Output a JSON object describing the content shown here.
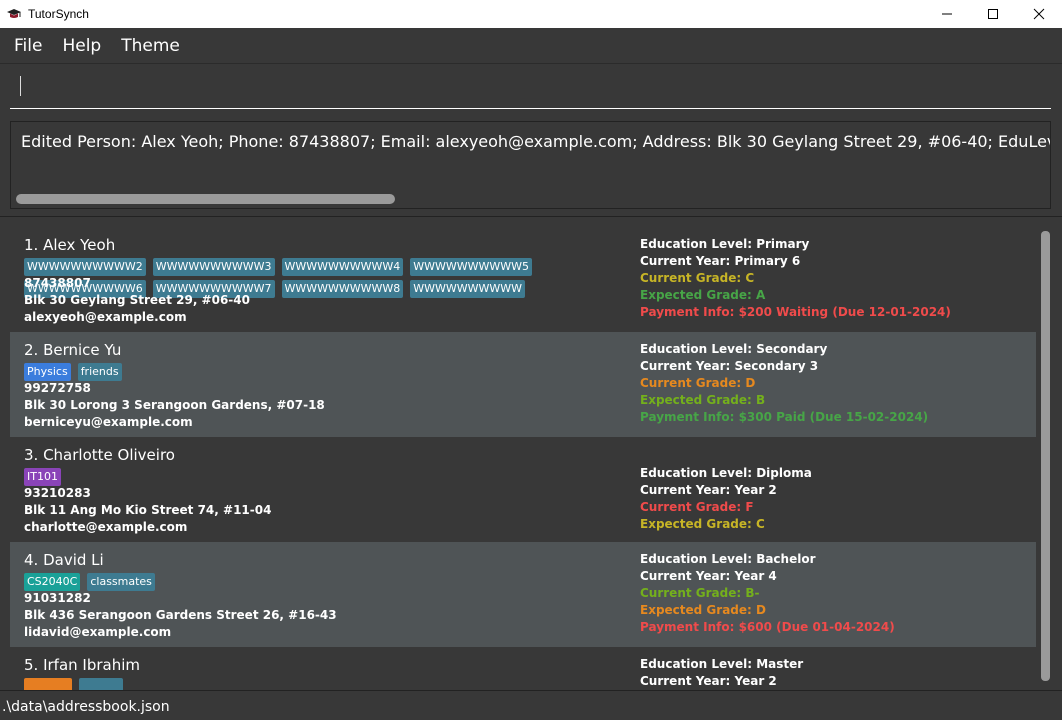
{
  "window": {
    "title": "TutorSynch"
  },
  "menu": [
    "File",
    "Help",
    "Theme"
  ],
  "command": {
    "value": ""
  },
  "result": {
    "text": "Edited Person: Alex Yeoh; Phone: 87438807; Email: alexyeoh@example.com; Address: Blk 30 Geylang Street 29, #06-40; EduLevel: Primary; Cu"
  },
  "colors": {
    "tag_default": "#3e7b91",
    "tag_physics": "#3b7ddd",
    "tag_it": "#8a44b8",
    "tag_cs": "#1aa198",
    "tag_orange": "#e67e22",
    "grade_yellow": "#c7b526",
    "grade_orange": "#e6891f",
    "grade_green": "#47a547",
    "grade_lime": "#74b01c",
    "red": "#f04b4b"
  },
  "persons": [
    {
      "name": "1. Alex Yeoh",
      "tags": [
        {
          "label": "WWWWWWWWWW2",
          "color": "#3e7b91"
        },
        {
          "label": "WWWWWWWWWW3",
          "color": "#3e7b91"
        },
        {
          "label": "WWWWWWWWWW4",
          "color": "#3e7b91"
        },
        {
          "label": "WWWWWWWWWW5",
          "color": "#3e7b91"
        },
        {
          "label": "WWWWWWWWWW6",
          "color": "#3e7b91"
        },
        {
          "label": "WWWWWWWWWW7",
          "color": "#3e7b91"
        },
        {
          "label": "WWWWWWWWWW8",
          "color": "#3e7b91"
        },
        {
          "label": "WWWWWWWWWW",
          "color": "#3e7b91"
        }
      ],
      "phone": "87438807",
      "address": "Blk 30 Geylang Street 29, #06-40",
      "email": "alexyeoh@example.com",
      "info": [
        {
          "text": "Education Level: Primary",
          "color": "#ffffff"
        },
        {
          "text": "Current Year: Primary 6",
          "color": "#ffffff"
        },
        {
          "text": "Current Grade: C",
          "color": "#c7b526"
        },
        {
          "text": "Expected Grade: A",
          "color": "#47a547"
        },
        {
          "text": "Payment Info: $200 Waiting (Due 12-01-2024)",
          "color": "#f04b4b"
        }
      ]
    },
    {
      "name": "2. Bernice Yu",
      "tags": [
        {
          "label": "Physics",
          "color": "#3b7ddd"
        },
        {
          "label": "friends",
          "color": "#3e7b91"
        }
      ],
      "phone": "99272758",
      "address": "Blk 30 Lorong 3 Serangoon Gardens, #07-18",
      "email": "berniceyu@example.com",
      "info": [
        {
          "text": "Education Level: Secondary",
          "color": "#ffffff"
        },
        {
          "text": "Current Year: Secondary 3",
          "color": "#ffffff"
        },
        {
          "text": "Current Grade: D",
          "color": "#e6891f"
        },
        {
          "text": "Expected Grade: B",
          "color": "#74b01c"
        },
        {
          "text": "Payment Info: $300 Paid (Due 15-02-2024)",
          "color": "#47a547"
        }
      ]
    },
    {
      "name": "3. Charlotte Oliveiro",
      "tags": [
        {
          "label": "IT101",
          "color": "#8a44b8"
        }
      ],
      "phone": "93210283",
      "address": "Blk 11 Ang Mo Kio Street 74, #11-04",
      "email": "charlotte@example.com",
      "info": [
        {
          "text": "Education Level: Diploma",
          "color": "#ffffff"
        },
        {
          "text": "Current Year: Year 2",
          "color": "#ffffff"
        },
        {
          "text": "Current Grade: F",
          "color": "#f04b4b"
        },
        {
          "text": "Expected Grade: C",
          "color": "#c7b526"
        }
      ]
    },
    {
      "name": "4. David Li",
      "tags": [
        {
          "label": "CS2040C",
          "color": "#1aa198"
        },
        {
          "label": "classmates",
          "color": "#3e7b91"
        }
      ],
      "phone": "91031282",
      "address": "Blk 436 Serangoon Gardens Street 26, #16-43",
      "email": "lidavid@example.com",
      "info": [
        {
          "text": "Education Level: Bachelor",
          "color": "#ffffff"
        },
        {
          "text": "Current Year: Year 4",
          "color": "#ffffff"
        },
        {
          "text": "Current Grade: B-",
          "color": "#74b01c"
        },
        {
          "text": "Expected Grade: D",
          "color": "#e6891f"
        },
        {
          "text": "Payment Info: $600 (Due 01-04-2024)",
          "color": "#f04b4b"
        }
      ]
    },
    {
      "name": "5. Irfan Ibrahim",
      "tags": [
        {
          "label": "",
          "color": "#e67e22"
        },
        {
          "label": "",
          "color": "#3e7b91"
        }
      ],
      "phone": "",
      "address": "",
      "email": "",
      "info": [
        {
          "text": "Education Level: Master",
          "color": "#ffffff"
        },
        {
          "text": "Current Year: Year 2",
          "color": "#ffffff"
        }
      ]
    }
  ],
  "status": {
    "path": ".\\data\\addressbook.json"
  }
}
